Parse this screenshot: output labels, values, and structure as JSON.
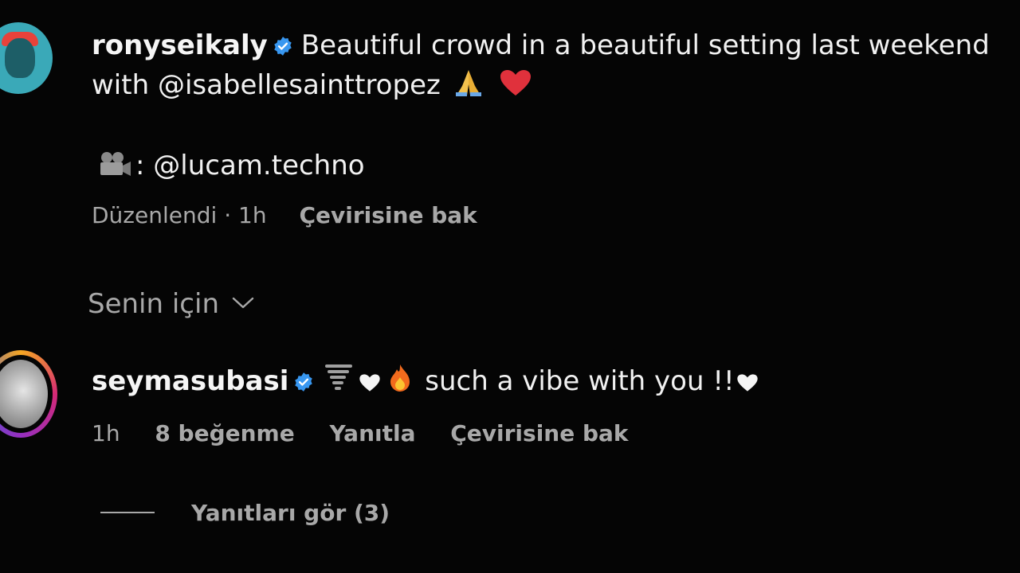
{
  "post": {
    "owner_username": "ronyseikaly",
    "caption_line1": "Beautiful crowd in a beautiful setting last weekend",
    "caption_line2": "with @isabellesainttropez",
    "credit_prefix": ":",
    "credit_handle": "@lucam.techno",
    "edited_label": "Düzenlendi",
    "separator": "·",
    "time": "1h",
    "translate_label": "Çevirisine bak"
  },
  "filter": {
    "label": "Senin için"
  },
  "comment": {
    "username": "seymasubasi",
    "text": "such a vibe with you !!",
    "time": "1h",
    "likes_label": "8 beğenme",
    "reply_label": "Yanıtla",
    "translate_label": "Çevirisine bak",
    "view_replies_label": "Yanıtları gör (3)"
  },
  "colors": {
    "background": "#050505",
    "text": "#f1f1f1",
    "muted": "#a8a8a8",
    "verified": "#3897f0",
    "heart_red": "#e0313c"
  },
  "icons": [
    "verified-badge-icon",
    "folded-hands-icon",
    "red-heart-icon",
    "film-camera-icon",
    "chevron-down-icon",
    "tornado-icon",
    "white-heart-icon",
    "fire-icon"
  ]
}
